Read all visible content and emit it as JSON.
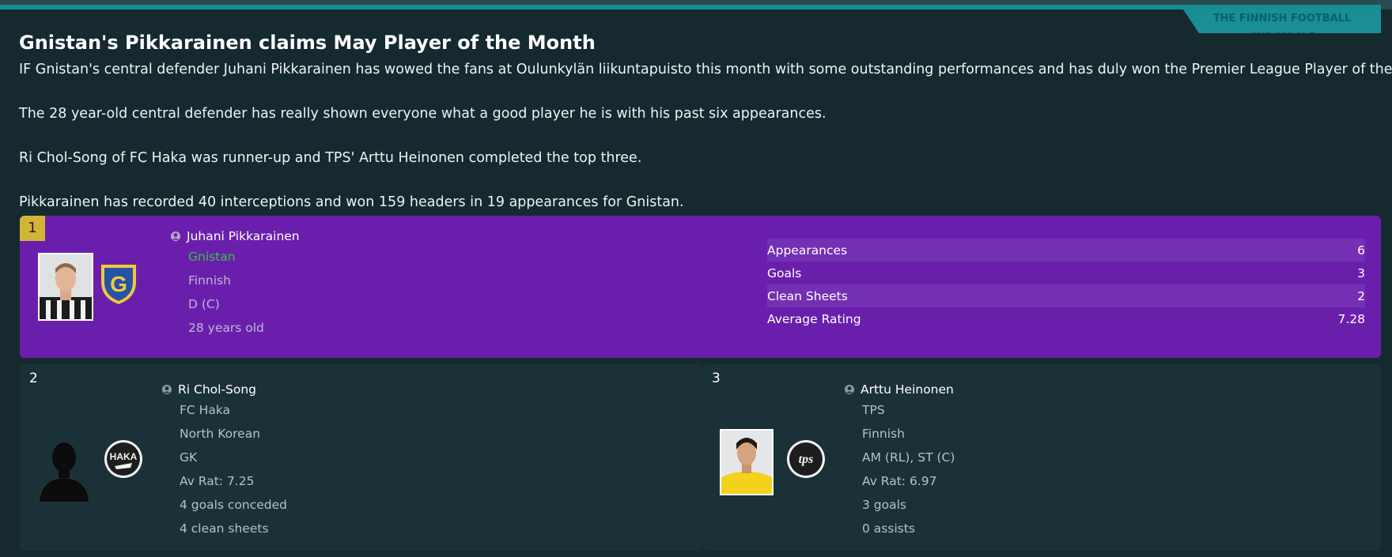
{
  "source": "THE FINNISH FOOTBALL CHRONICLE",
  "headline": "Gnistan's Pikkarainen claims May Player of the Month",
  "paragraphs": [
    "IF Gnistan's central defender Juhani Pikkarainen has wowed the fans at Oulunkylän liikuntapuisto this month with some outstanding performances and has duly won the Premier League Player of the Month.",
    "The 28 year-old central defender has really shown everyone what a good player he is with his past six appearances.",
    "Ri Chol-Song of FC Haka was runner-up and TPS' Arttu Heinonen completed the top three.",
    "Pikkarainen has recorded 40 interceptions and won 159 headers in 19 appearances for Gnistan."
  ],
  "winner": {
    "rank": "1",
    "name": "Juhani Pikkarainen",
    "club": "Gnistan",
    "nationality": "Finnish",
    "position": "D (C)",
    "age": "28 years old",
    "club_color": "#37c24a",
    "stats": [
      {
        "label": "Appearances",
        "value": "6"
      },
      {
        "label": "Goals",
        "value": "3"
      },
      {
        "label": "Clean Sheets",
        "value": "2"
      },
      {
        "label": "Average Rating",
        "value": "7.28"
      }
    ]
  },
  "runner_up": {
    "rank": "2",
    "name": "Ri Chol-Song",
    "club": "FC Haka",
    "nationality": "North Korean",
    "position": "GK",
    "rating": "Av Rat: 7.25",
    "stat1": "4 goals conceded",
    "stat2": "4 clean sheets"
  },
  "third": {
    "rank": "3",
    "name": "Arttu Heinonen",
    "club": "TPS",
    "nationality": "Finnish",
    "position": "AM (RL), ST (C)",
    "rating": "Av Rat: 6.97",
    "stat1": "3 goals",
    "stat2": "0 assists"
  },
  "crest_text": {
    "gnistan": "G",
    "haka": "HAKA",
    "tps": "tps"
  },
  "colors": {
    "winner_bg": "#6a1fac",
    "gold_badge": "#d2b437",
    "teal_accent": "#168c93"
  }
}
